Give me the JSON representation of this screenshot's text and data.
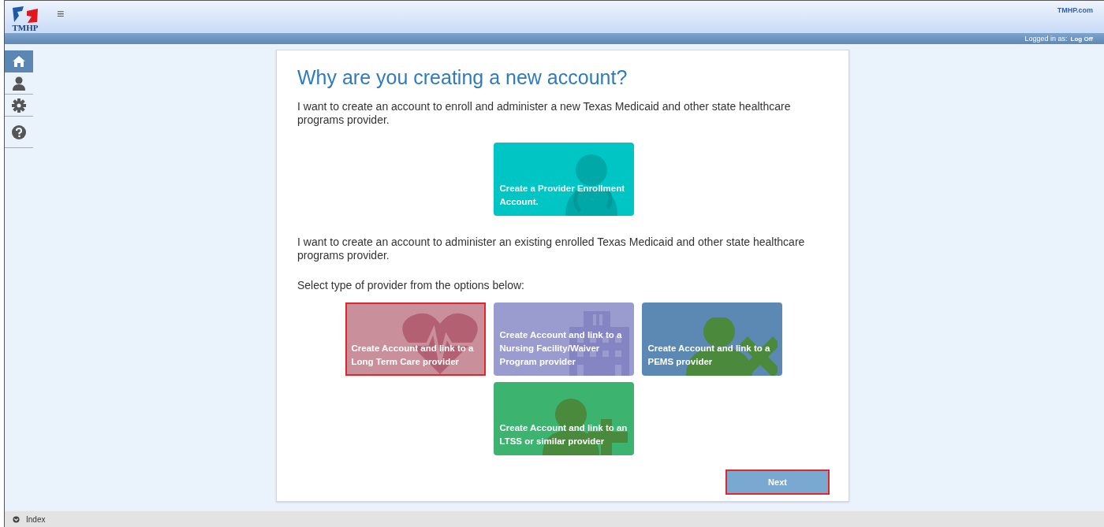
{
  "header": {
    "logo": "TMHP",
    "menu_icon": "≡",
    "link": "TMHP.com"
  },
  "user_bar": {
    "label": "Logged in as:",
    "logout": "Log Off"
  },
  "sidebar": {
    "items": [
      {
        "kind": "home",
        "selected": true
      },
      {
        "kind": "user",
        "selected": false
      },
      {
        "kind": "settings",
        "selected": false
      },
      {
        "kind": "help",
        "selected": false
      }
    ]
  },
  "card": {
    "title": "Why are you creating a new account?",
    "paragraph_1": "I want to create an account to enroll and administer a new Texas Medicaid and other state healthcare programs provider.",
    "enroll_tile": {
      "kind": "doctor",
      "label": "Create a Provider Enrollment Account.",
      "color": "#00c5c5",
      "selected": false
    },
    "paragraph_2": "I want to create an account to administer an existing enrolled Texas Medicaid and other state healthcare programs provider.",
    "prompt": "Select type of provider from the options below:",
    "tiles": [
      {
        "kind": "heart",
        "label": "Create Account and link to a Long Term Care provider",
        "color": "#c98f9b",
        "selected": true
      },
      {
        "kind": "building",
        "label": "Create Account and link to a Nursing Facility/Waiver Program provider",
        "color": "#9a9bcf",
        "selected": false
      },
      {
        "kind": "person-x",
        "label": "Create Account and link to a PEMS provider",
        "color": "#5c89b4",
        "selected": false
      },
      {
        "kind": "person-plus",
        "label": "Create Account and link to an LTSS or similar provider",
        "color": "#3db370",
        "selected": false
      }
    ],
    "next_button": {
      "label": "Next",
      "highlighted": true
    }
  },
  "footer": {
    "label": "Index"
  }
}
